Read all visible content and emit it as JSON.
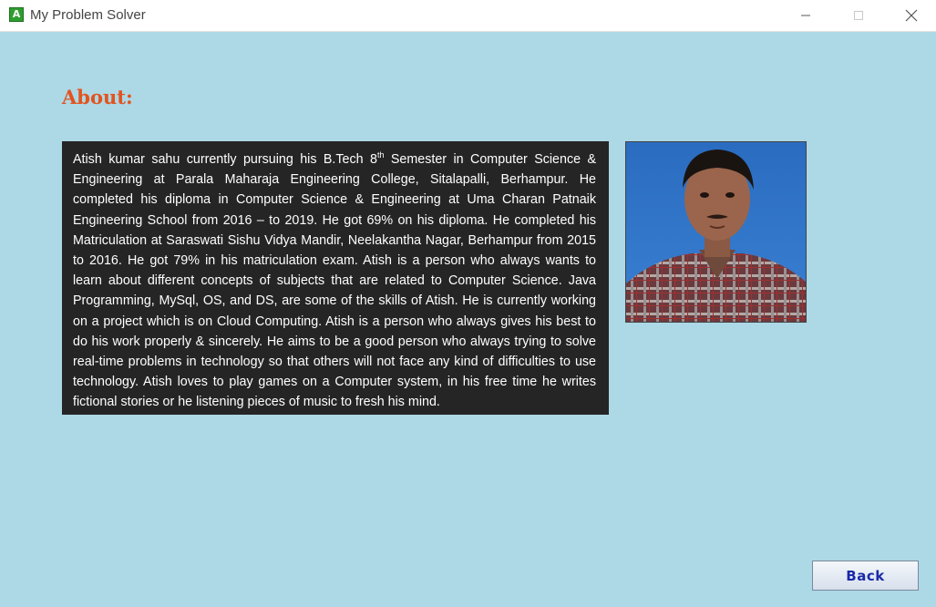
{
  "window": {
    "title": "My Problem Solver",
    "icon_letter": "A"
  },
  "heading": "About:",
  "about": {
    "part1": "Atish kumar sahu currently pursuing his B.Tech 8",
    "superscript": "th",
    "part2": " Semester in Computer Science & Engineering at Parala Maharaja Engineering College, Sitalapalli, Berhampur. He completed his diploma in Computer Science & Engineering at Uma Charan Patnaik Engineering School from 2016 – to 2019. He got 69% on his diploma. He completed his Matriculation at Saraswati Sishu Vidya Mandir, Neelakantha Nagar, Berhampur from 2015 to 2016. He got 79% in his matriculation exam. Atish is a person who always wants to learn about different concepts of subjects that are related to Computer Science. Java Programming, MySql, OS, and DS, are some of the skills of Atish. He is currently working on a project which is on Cloud Computing. Atish is a person who always gives his best to do his work properly & sincerely. He aims to be a good person who always trying to solve real-time problems in technology so that others will not face any kind of difficulties to use technology. Atish loves to play games on a Computer system, in his free time he writes fictional stories or he listening pieces of music to fresh his mind."
  },
  "back_button": "Back",
  "colors": {
    "background": "#add8e6",
    "heading": "#e2541e",
    "text_box": "#252525",
    "button_text": "#1a2aa8"
  }
}
